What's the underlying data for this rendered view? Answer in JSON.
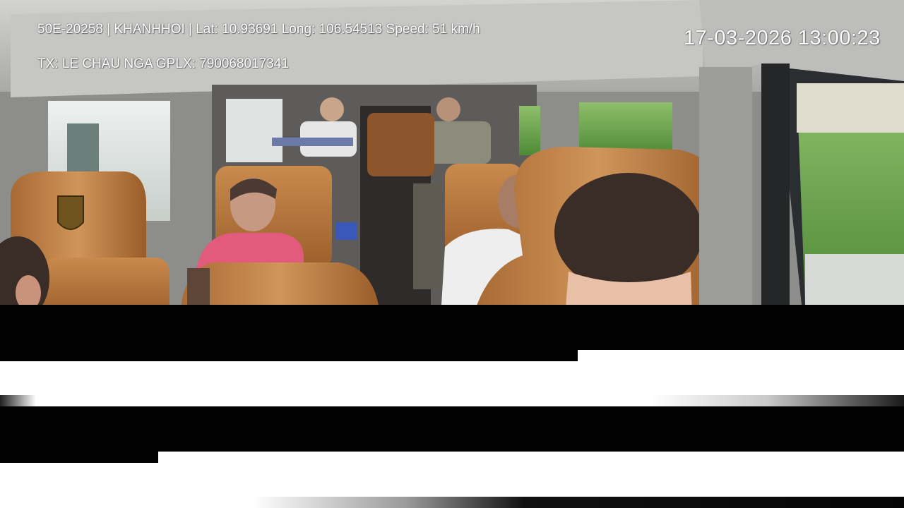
{
  "overlay": {
    "vehicle_line": "50E-20258 | KHANHHOI | Lat: 10.93691 Long: 106.54513 Speed: 51 km/h",
    "driver_line": "TX: LE CHAU NGA GPLX: 790068017341",
    "timestamp": "17-03-2026 13:00:23"
  },
  "colors": {
    "seat_leather": "#b8763c",
    "ceiling": "#c9c9c7",
    "window_foliage": "#6fa84a",
    "pink_shirt": "#e25b7c"
  }
}
